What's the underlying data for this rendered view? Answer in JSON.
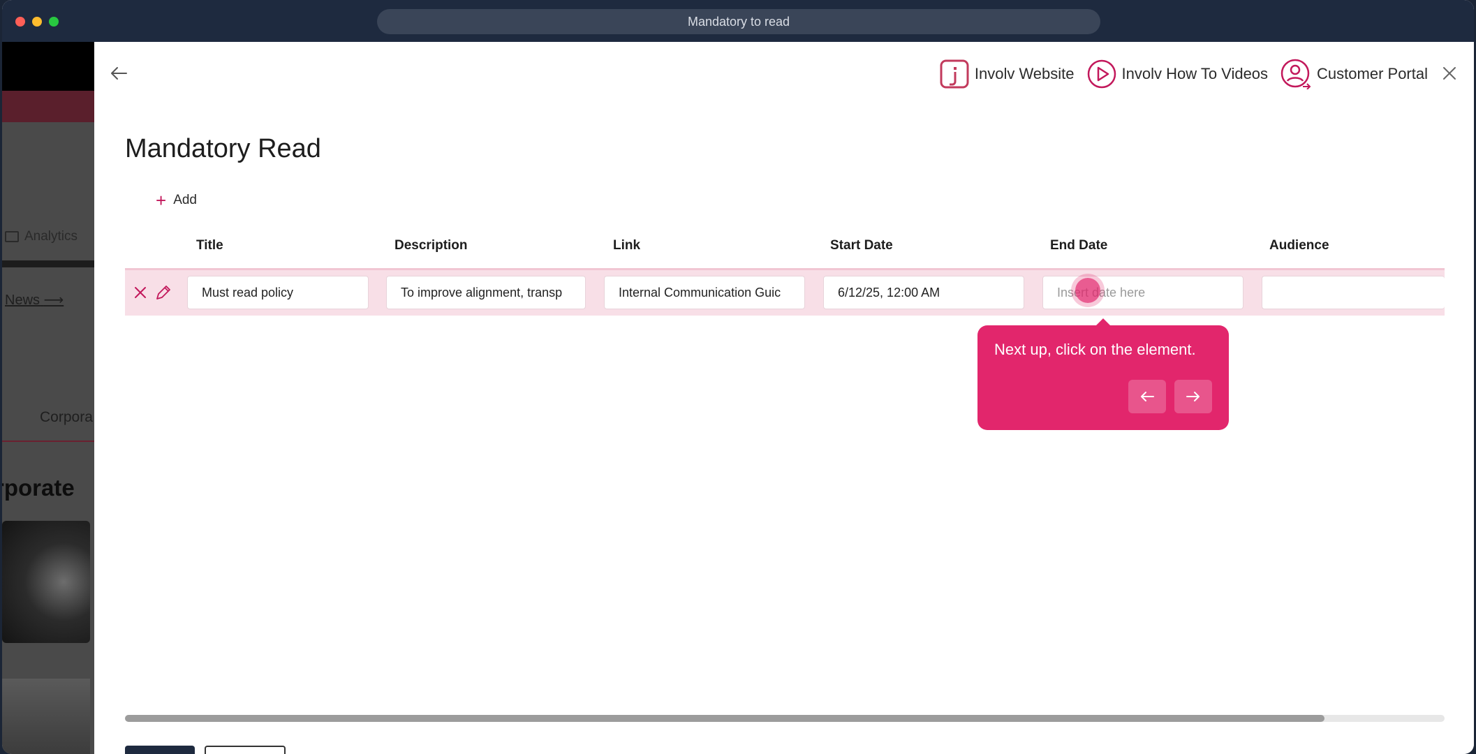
{
  "window": {
    "url_title": "Mandatory to read"
  },
  "background_app": {
    "analytics_label": "Analytics",
    "news_link": "News",
    "corporate_tab": "Corpora",
    "corporate_heading": "rporate"
  },
  "header": {
    "links": [
      {
        "label": "Involv Website",
        "icon": "involv-logo-icon"
      },
      {
        "label": "Involv How To Videos",
        "icon": "play-circle-icon"
      },
      {
        "label": "Customer Portal",
        "icon": "user-circle-icon"
      }
    ]
  },
  "page": {
    "title": "Mandatory Read",
    "add_label": "Add"
  },
  "table": {
    "columns": [
      "Title",
      "Description",
      "Link",
      "Start Date",
      "End Date",
      "Audience"
    ],
    "row": {
      "title": "Must read policy",
      "description": "To improve alignment, transp",
      "link": "Internal Communication Guic",
      "start_date": "6/12/25, 12:00 AM",
      "end_date_placeholder": "Insert date here",
      "audience": ""
    }
  },
  "tooltip": {
    "message": "Next up, click on the element."
  },
  "colors": {
    "accent": "#e2266c",
    "row_highlight": "#f8dfe7",
    "titlebar": "#1e2a3f"
  }
}
